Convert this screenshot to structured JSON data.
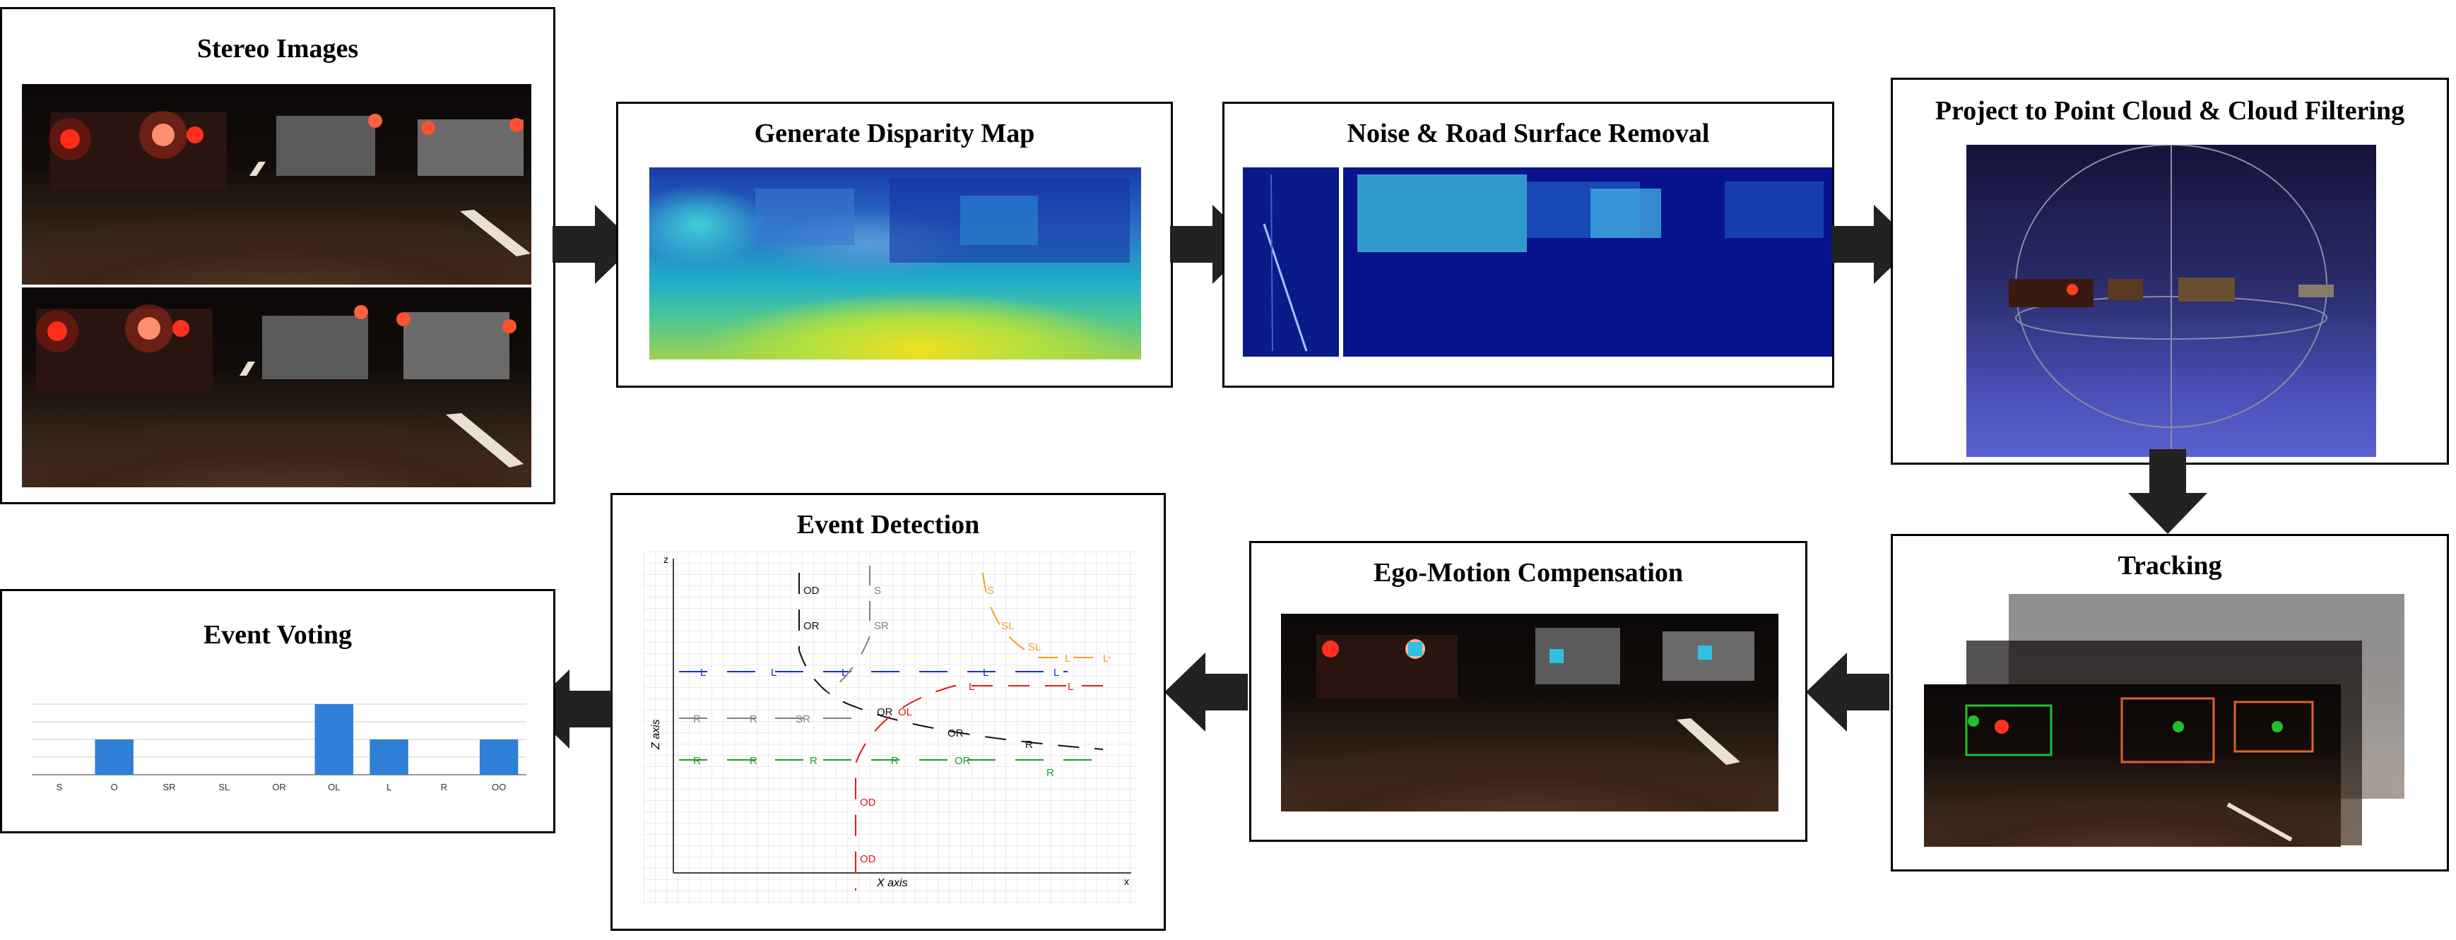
{
  "stages": {
    "stereo": "Stereo Images",
    "disparity": "Generate Disparity Map",
    "noise": "Noise & Road Surface Removal",
    "pointcloud": "Project to Point Cloud & Cloud Filtering",
    "tracking": "Tracking",
    "egomotion": "Ego-Motion Compensation",
    "event_detection": "Event Detection",
    "event_voting": "Event Voting"
  },
  "event_detection": {
    "z_axis_label": "Z axis",
    "x_axis_label": "X axis",
    "z_tick": "z",
    "x_tick": "x",
    "tracks": {
      "L": "L",
      "R": "R",
      "S": "S",
      "SR": "SR",
      "SL": "SL",
      "OL": "OL",
      "OR": "OR",
      "OD": "OD"
    }
  },
  "chart_data": {
    "type": "bar",
    "title": "Event Voting",
    "categories": [
      "S",
      "O",
      "SR",
      "SL",
      "OR",
      "OL",
      "L",
      "R",
      "OO"
    ],
    "values": [
      0,
      1,
      0,
      0,
      0,
      2,
      1,
      0,
      1
    ],
    "ylim": [
      0,
      2
    ],
    "grid": true,
    "xlabel": "",
    "ylabel": "",
    "bar_color": "#2f7fd6"
  },
  "colors": {
    "arrow": "#222222",
    "blue_track": "#1a2fd0",
    "red_track": "#e01818",
    "green_track": "#1f9a2a",
    "orange_track": "#f0a020",
    "gray_track": "#808080",
    "black_track": "#111111"
  }
}
